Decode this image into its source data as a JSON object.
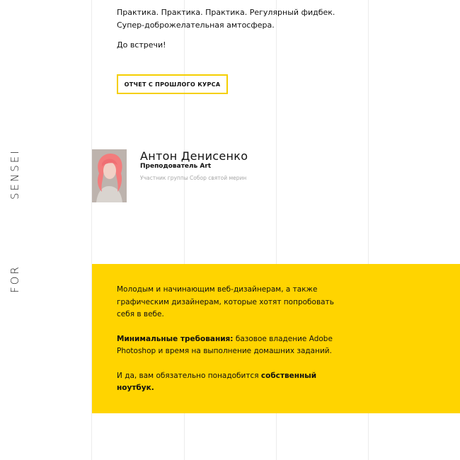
{
  "side_labels": {
    "sensei": "SENSEI",
    "for": "FOR"
  },
  "intro": {
    "line1": "Практика. Практика. Практика. Регулярный фидбек.",
    "line2": "Супер-доброжелательная амтосфера.",
    "goodbye": "До встречи!"
  },
  "report_button": {
    "label": "ОТЧЕТ С ПРОШЛОГО КУРСА"
  },
  "teacher": {
    "name": "Антон Денисенко",
    "role": "Преподователь Art",
    "note": "Участник группы Собор святой мерин"
  },
  "audience": {
    "paragraph1": "Молодым и начинающим веб-дизайнерам, а также графическим дизайнерам, которые хотят попробовать себя в вебе.",
    "requirements_label": "Минимальные требования:",
    "requirements_text": " базовое владение Adobe Photoshop и время на выполнение домашних заданий.",
    "laptop_prefix": "И да, вам обязательно понадобится ",
    "laptop_bold": "собственный ноутбук."
  },
  "colors": {
    "accent_yellow": "#ffd400",
    "button_border": "#f5cf00",
    "grid_line": "#ececec",
    "muted_text": "#a7a7a7"
  }
}
